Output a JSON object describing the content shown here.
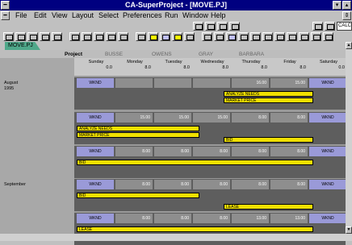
{
  "window": {
    "title": "CA-SuperProject - [MOVE.PJ]"
  },
  "menu": [
    {
      "label": "File"
    },
    {
      "label": "Edit"
    },
    {
      "label": "View"
    },
    {
      "label": "Layout"
    },
    {
      "label": "Select"
    },
    {
      "label": "Preferences"
    },
    {
      "label": "Run"
    },
    {
      "label": "Window"
    },
    {
      "label": "Help"
    }
  ],
  "toolbar_right": {
    "calc_label": "CALC"
  },
  "tabs": {
    "active": "MOVE.PJ"
  },
  "view_tabs": [
    "Project",
    "BUSSE",
    "OWENS",
    "GRAY",
    "BARBARA"
  ],
  "days": [
    {
      "name": "Sunday",
      "hours": "0.0"
    },
    {
      "name": "Monday",
      "hours": "8.0"
    },
    {
      "name": "Tuesday",
      "hours": "8.0"
    },
    {
      "name": "Wednesday",
      "hours": "8.0"
    },
    {
      "name": "Thursday",
      "hours": "8.0"
    },
    {
      "name": "Friday",
      "hours": "8.0"
    },
    {
      "name": "Saturday",
      "hours": "0.0"
    }
  ],
  "months": {
    "august": "August",
    "year": "1995",
    "september": "September"
  },
  "weeks": [
    {
      "cells": [
        "WKND",
        "",
        "",
        "",
        "16.00",
        "15.00",
        "WKND"
      ],
      "bars": [
        {
          "label": "ANALYZE NEEDS"
        },
        {
          "label": "MARKET PRICE"
        }
      ]
    },
    {
      "cells": [
        "WKND",
        "15.00",
        "15.00",
        "15.00",
        "8.00",
        "8.00",
        "WKND"
      ],
      "bars": [
        {
          "label": "ANALYZE NEEDS"
        },
        {
          "label": "MARKET PRICE"
        },
        {
          "label": "BID"
        }
      ]
    },
    {
      "cells": [
        "WKND",
        "8.00",
        "8.00",
        "8.00",
        "8.00",
        "8.00",
        "WKND"
      ],
      "bars": [
        {
          "label": "BID"
        }
      ]
    },
    {
      "cells": [
        "WKND",
        "8.00",
        "8.00",
        "8.00",
        "8.00",
        "8.00",
        "WKND"
      ],
      "bars": [
        {
          "label": "BID"
        },
        {
          "label": "LEASE"
        }
      ]
    },
    {
      "cells": [
        "WKND",
        "8.00",
        "8.00",
        "8.00",
        "13.00",
        "13.00",
        "WKND"
      ],
      "bars": [
        {
          "label": "LEASE"
        }
      ]
    }
  ]
}
